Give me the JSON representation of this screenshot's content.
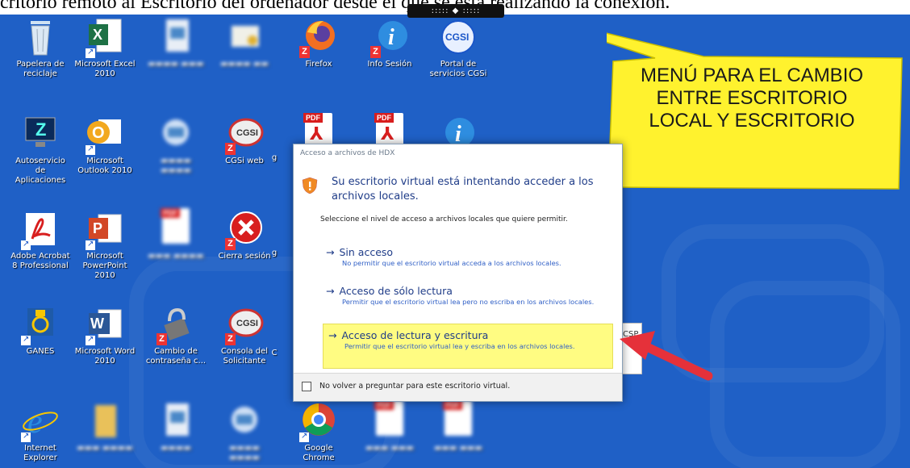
{
  "header": {
    "text": "critorio remoto al Escritorio del ordenador desde el que se está realizando la conexión."
  },
  "toolbar_handle": {
    "text": "::::: ◆ :::::"
  },
  "icons": [
    {
      "label": "Papelera de reciclaje"
    },
    {
      "label": "Microsoft Excel 2010"
    },
    {
      "label": "Firefox"
    },
    {
      "label": "Info Sesión"
    },
    {
      "label": "Portal de servicios CGSi"
    },
    {
      "label": "Autoservicio de Aplicaciones"
    },
    {
      "label": "Microsoft Outlook 2010"
    },
    {
      "label": "CGSi web"
    },
    {
      "label": "Adobe Acrobat 8 Professional"
    },
    {
      "label": "Microsoft PowerPoint 2010"
    },
    {
      "label": "Cierra sesión"
    },
    {
      "label": "GANES"
    },
    {
      "label": "Microsoft Word 2010"
    },
    {
      "label": "Cambio de contraseña c..."
    },
    {
      "label": "Consola del Solicitante"
    },
    {
      "label": "Internet Explorer"
    },
    {
      "label": "Google Chrome"
    }
  ],
  "icon_badges": {
    "cgsi": "CGSI",
    "pdf": "PDF",
    "z": "Z",
    "i": "i"
  },
  "callout": {
    "text": "MENÚ PARA EL CAMBIO ENTRE ESCRITORIO LOCAL Y ESCRITORIO"
  },
  "dialog": {
    "title": "Acceso a archivos de HDX",
    "heading": "Su escritorio virtual está intentando acceder a los archivos locales.",
    "subheading": "Seleccione el nivel de acceso a archivos locales que quiere permitir.",
    "options": [
      {
        "label": "Sin acceso",
        "desc": "No permitir que el escritorio virtual acceda a los archivos locales."
      },
      {
        "label": "Acceso de sólo lectura",
        "desc": "Permitir que el escritorio virtual lea pero no escriba en los archivos locales."
      },
      {
        "label": "Acceso de lectura y escritura",
        "desc": "Permitir que el escritorio virtual lea y escriba en los archivos locales."
      }
    ],
    "checkbox_label": "No volver a preguntar para este escritorio virtual."
  },
  "csp_tab": {
    "text": "CSP"
  },
  "colors": {
    "desktop": "#1f60c6",
    "callout": "#fff22e",
    "highlight": "#fffc82",
    "arrow": "#e5313a",
    "link": "#1f3c88"
  }
}
